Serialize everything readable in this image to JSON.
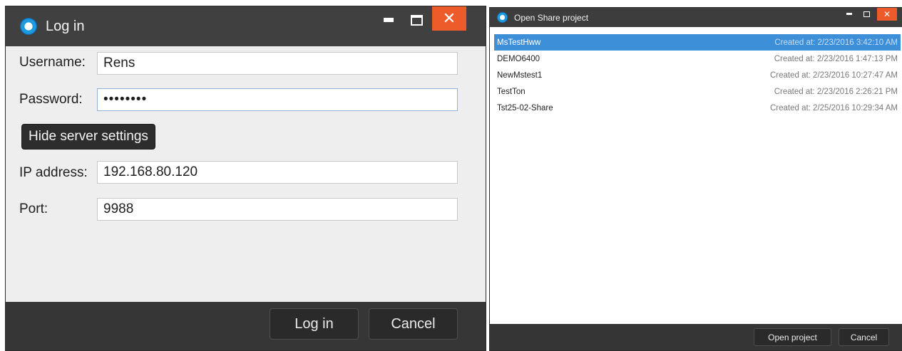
{
  "login_window": {
    "title": "Log in",
    "fields": {
      "username_label": "Username:",
      "username_value": "Rens",
      "password_label": "Password:",
      "password_value": "••••••••",
      "ip_label": "IP address:",
      "ip_value": "192.168.80.120",
      "port_label": "Port:",
      "port_value": "9988"
    },
    "server_settings_button": "Hide server settings",
    "login_button": "Log in",
    "cancel_button": "Cancel",
    "window_controls": {
      "minimize": "minimize-icon",
      "maximize": "maximize-icon",
      "close": "✕"
    }
  },
  "open_window": {
    "title": "Open Share project",
    "projects": [
      {
        "name": "MsTestHww",
        "created": "Created at: 2/23/2016 3:42:10 AM",
        "selected": true
      },
      {
        "name": "DEMO6400",
        "created": "Created at: 2/23/2016 1:47:13 PM",
        "selected": false
      },
      {
        "name": "NewMstest1",
        "created": "Created at: 2/23/2016 10:27:47 AM",
        "selected": false
      },
      {
        "name": "TestTon",
        "created": "Created at: 2/23/2016 2:26:21 PM",
        "selected": false
      },
      {
        "name": "Tst25-02-Share",
        "created": "Created at: 2/25/2016 10:29:34 AM",
        "selected": false
      }
    ],
    "open_button": "Open project",
    "cancel_button": "Cancel",
    "window_controls": {
      "minimize": "minimize-icon",
      "maximize": "maximize-icon",
      "close": "✕"
    }
  },
  "colors": {
    "titlebar": "#404040",
    "close_button": "#ee5b2a",
    "selection": "#3d8fd8",
    "footer": "#363636"
  }
}
